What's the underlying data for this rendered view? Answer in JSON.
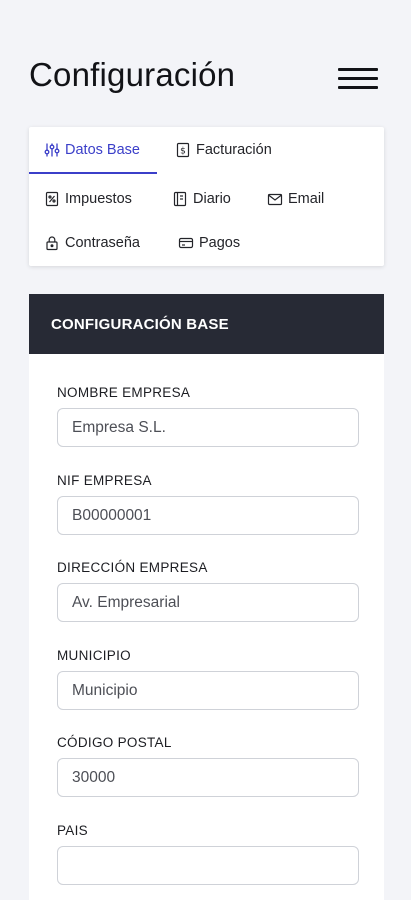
{
  "header": {
    "title": "Configuración"
  },
  "tabs": [
    {
      "label": "Datos Base",
      "icon": "sliders-icon",
      "active": true
    },
    {
      "label": "Facturación",
      "icon": "invoice-icon",
      "active": false
    },
    {
      "label": "Impuestos",
      "icon": "tax-icon",
      "active": false
    },
    {
      "label": "Diario",
      "icon": "journal-icon",
      "active": false
    },
    {
      "label": "Email",
      "icon": "envelope-icon",
      "active": false
    },
    {
      "label": "Contraseña",
      "icon": "lock-icon",
      "active": false
    },
    {
      "label": "Pagos",
      "icon": "card-icon",
      "active": false
    }
  ],
  "panel": {
    "title": "CONFIGURACIÓN BASE",
    "fields": [
      {
        "label": "NOMBRE EMPRESA",
        "value": "Empresa S.L."
      },
      {
        "label": "NIF EMPRESA",
        "value": "B00000001"
      },
      {
        "label": "DIRECCIÓN EMPRESA",
        "value": "Av. Empresarial"
      },
      {
        "label": "MUNICIPIO",
        "value": "Municipio"
      },
      {
        "label": "CÓDIGO POSTAL",
        "value": "30000"
      },
      {
        "label": "PAIS",
        "value": ""
      }
    ]
  },
  "colors": {
    "accent": "#3b3fc9",
    "panel_header": "#272a35",
    "background": "#f3f4f8"
  }
}
